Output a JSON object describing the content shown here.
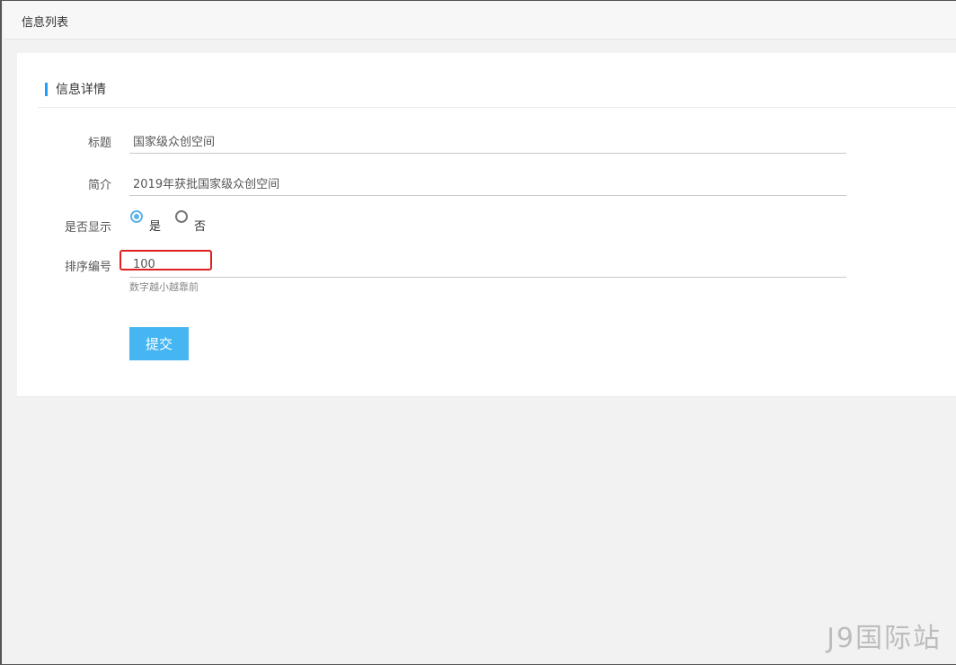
{
  "header": {
    "breadcrumb": "信息列表"
  },
  "section": {
    "title": "信息详情"
  },
  "form": {
    "title_label": "标题",
    "title_value": "国家级众创空间",
    "intro_label": "简介",
    "intro_value": "2019年获批国家级众创空间",
    "display_label": "是否显示",
    "display_options": [
      {
        "label": "是",
        "checked": true
      },
      {
        "label": "否",
        "checked": false
      }
    ],
    "sort_label": "排序编号",
    "sort_value": "100",
    "sort_hint": "数字越小越靠前",
    "submit_label": "提交"
  },
  "watermark": "J9国际站",
  "colors": {
    "accent": "#1e9fff",
    "button": "#45b6f2",
    "highlight_box": "#e02020"
  }
}
